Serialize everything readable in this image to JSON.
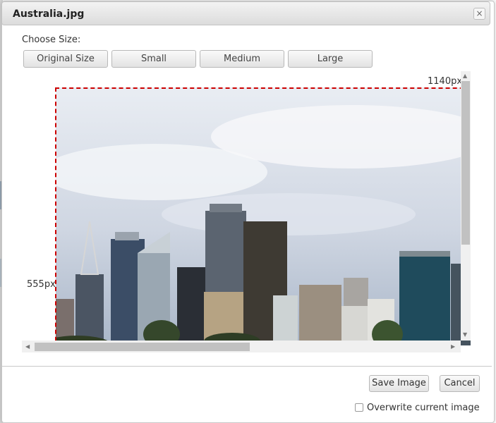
{
  "dialog": {
    "title": "Australia.jpg",
    "close_glyph": "×"
  },
  "size_picker": {
    "label": "Choose Size:",
    "buttons": [
      "Original Size",
      "Small",
      "Medium",
      "Large"
    ]
  },
  "image": {
    "width_label": "1140px",
    "height_label": "555px",
    "description": "Sydney city skyline photo",
    "accent_crop_color": "#cc0000"
  },
  "footer": {
    "save_label": "Save Image",
    "cancel_label": "Cancel",
    "overwrite_label": "Overwrite current image",
    "overwrite_checked": false
  },
  "scrollbars": {
    "vertical_position": 0,
    "horizontal_position": 0
  }
}
